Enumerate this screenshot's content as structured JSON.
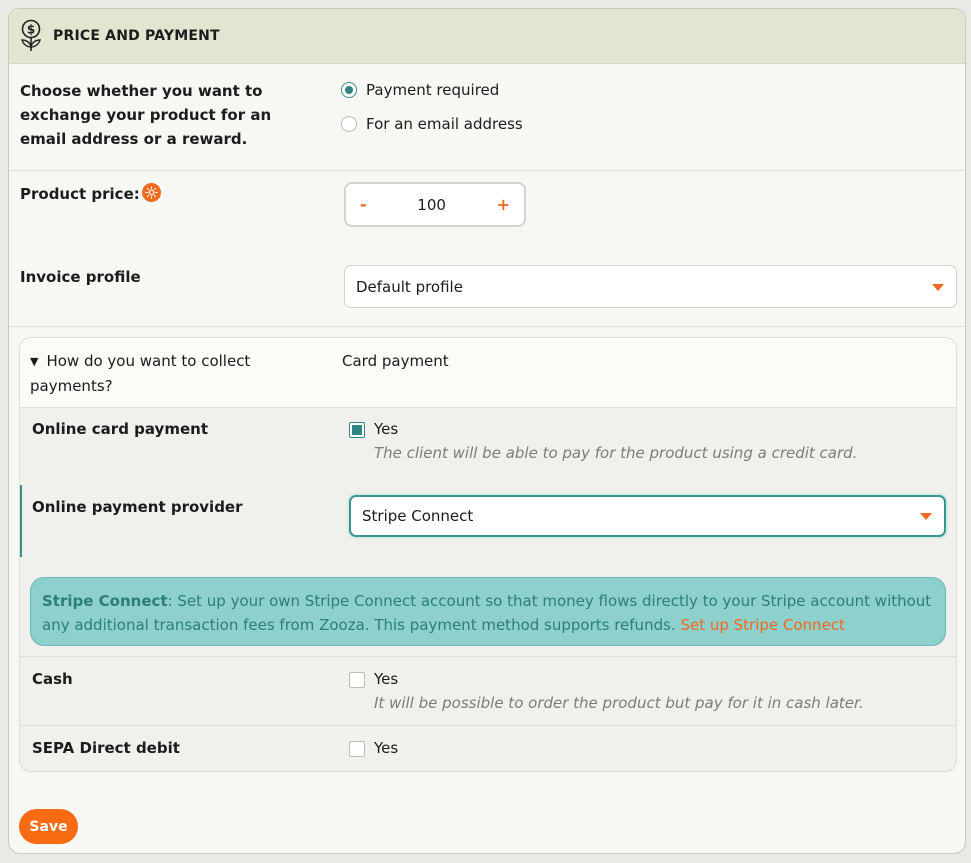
{
  "header": {
    "title": "PRICE AND PAYMENT",
    "icon": "money-plant-icon"
  },
  "exchange": {
    "label": "Choose whether you want to exchange your product for an email address or a reward.",
    "options": [
      {
        "label": "Payment required",
        "selected": true
      },
      {
        "label": "For an email address",
        "selected": false
      }
    ]
  },
  "price": {
    "label": "Product price:",
    "info_icon": "sun-icon",
    "minus": "-",
    "value": "100",
    "plus": "+"
  },
  "invoice": {
    "label": "Invoice profile",
    "selected": "Default profile"
  },
  "collect": {
    "question": "How do you want to collect payments?",
    "answer": "Card payment",
    "online_card": {
      "label": "Online card payment",
      "checkbox_label": "Yes",
      "checked": true,
      "hint": "The client will be able to pay for the product using a credit card."
    },
    "provider": {
      "label": "Online payment provider",
      "selected": "Stripe Connect"
    },
    "alert": {
      "strong": "Stripe Connect",
      "text": ": Set up your own Stripe Connect account so that money flows directly to your Stripe account without any additional transaction fees from Zooza. This payment method supports refunds. ",
      "link": "Set up Stripe Connect"
    },
    "cash": {
      "label": "Cash",
      "checkbox_label": "Yes",
      "checked": false,
      "hint": "It will be possible to order the product but pay for it in cash later."
    },
    "sepa": {
      "label": "SEPA Direct debit",
      "checkbox_label": "Yes",
      "checked": false
    }
  },
  "actions": {
    "save_label": "Save"
  },
  "colors": {
    "accent": "#f86b12",
    "teal": "#2f8583",
    "alert_bg": "#8ed0cb",
    "header_bg": "#e3e5d0"
  }
}
